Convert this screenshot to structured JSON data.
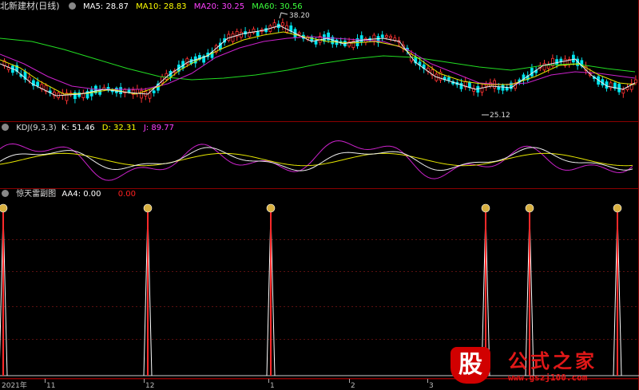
{
  "main_panel": {
    "title": "北新建材(日线)",
    "ma": [
      {
        "label": "MA5: 28.87",
        "color": "#ffffff"
      },
      {
        "label": "MA10: 28.83",
        "color": "#ffff00"
      },
      {
        "label": "MA20: 30.25",
        "color": "#ff00ff"
      },
      {
        "label": "MA60: 30.56",
        "color": "#00ff00"
      }
    ],
    "high_label": "38.20",
    "low_label": "25.12"
  },
  "kdj_panel": {
    "title": "KDJ(9,3,3)",
    "k": "K: 51.46",
    "d": "D: 32.31",
    "j": "J: 89.77",
    "k_color": "#ffffff",
    "d_color": "#ffff00",
    "j_color": "#ff00ff"
  },
  "signal_panel": {
    "title": "惊天雷副图",
    "aa4": "AA4: 0.00",
    "value": "0.00",
    "value_color": "#ff2020"
  },
  "time_axis": [
    "2021年",
    "11",
    "12",
    "1",
    "2",
    "3"
  ],
  "watermark": {
    "logo": "股",
    "name": "公式之家",
    "url": "www.gszj100.com"
  },
  "colors": {
    "up": "#ff3333",
    "down": "#00e5ee",
    "separator": "#8b0000",
    "grid": "#5a1010"
  }
}
